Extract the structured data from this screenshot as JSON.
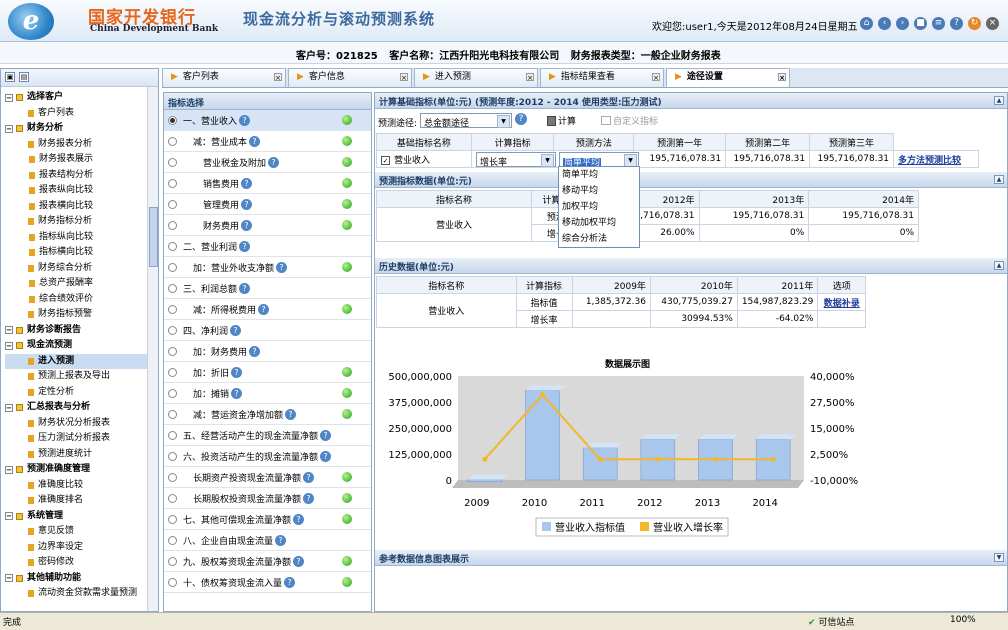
{
  "header": {
    "bank_name_cn": "国家开发银行",
    "bank_name_en": "China Development Bank",
    "system_title": "现金流分析与滚动预测系统",
    "welcome": "欢迎您:user1,今天是2012年08月24日星期五"
  },
  "toolbar_icons": [
    "home-icon",
    "back-icon",
    "forward-icon",
    "stop-icon",
    "book-icon",
    "help-icon",
    "refresh-icon",
    "exit-icon"
  ],
  "customer": {
    "id_label": "客户号：021825",
    "name_label": "客户名称：江西升阳光电科技有限公司",
    "report_type_label": "财务报表类型：一般企业财务报表"
  },
  "sidebar": {
    "items": [
      {
        "label": "选择客户",
        "level": 0,
        "bold": true
      },
      {
        "label": "客户列表",
        "level": 1
      },
      {
        "label": "财务分析",
        "level": 0,
        "bold": true
      },
      {
        "label": "财务报表分析",
        "level": 1
      },
      {
        "label": "财务报表展示",
        "level": 2
      },
      {
        "label": "报表结构分析",
        "level": 2
      },
      {
        "label": "报表纵向比较",
        "level": 2
      },
      {
        "label": "报表横向比较",
        "level": 2
      },
      {
        "label": "财务指标分析",
        "level": 1
      },
      {
        "label": "指标纵向比较",
        "level": 2
      },
      {
        "label": "指标横向比较",
        "level": 2
      },
      {
        "label": "财务综合分析",
        "level": 1
      },
      {
        "label": "总资产报酬率",
        "level": 2
      },
      {
        "label": "综合绩效评价",
        "level": 2
      },
      {
        "label": "财务指标预警",
        "level": 1
      },
      {
        "label": "财务诊断报告",
        "level": 0,
        "bold": true
      },
      {
        "label": "现金流预测",
        "level": 0,
        "bold": true
      },
      {
        "label": "进入预测",
        "level": 1,
        "bold": true,
        "selected": true
      },
      {
        "label": "预测上报表及导出",
        "level": 1
      },
      {
        "label": "定性分析",
        "level": 1
      },
      {
        "label": "汇总报表与分析",
        "level": 0,
        "bold": true
      },
      {
        "label": "财务状况分析报表",
        "level": 1
      },
      {
        "label": "压力测试分析报表",
        "level": 1
      },
      {
        "label": "预测进度统计",
        "level": 1
      },
      {
        "label": "预测准确度管理",
        "level": 0,
        "bold": true
      },
      {
        "label": "准确度比较",
        "level": 1
      },
      {
        "label": "准确度排名",
        "level": 1
      },
      {
        "label": "系统管理",
        "level": 0,
        "bold": true
      },
      {
        "label": "意见反馈",
        "level": 1
      },
      {
        "label": "边界率设定",
        "level": 1
      },
      {
        "label": "密码修改",
        "level": 1
      },
      {
        "label": "其他辅助功能",
        "level": 0,
        "bold": true
      },
      {
        "label": "流动资金贷款需求量预测",
        "level": 1
      }
    ]
  },
  "tabs": [
    {
      "label": "客户列表",
      "active": false
    },
    {
      "label": "客户信息",
      "active": false
    },
    {
      "label": "进入预测",
      "active": false
    },
    {
      "label": "指标结果查看",
      "active": false
    },
    {
      "label": "途径设置",
      "active": true
    }
  ],
  "indicator_panel": {
    "title": "指标选择",
    "items": [
      {
        "label": "一、营业收入",
        "help": true,
        "green": true,
        "selected": true
      },
      {
        "label": "减：营业成本",
        "help": true,
        "green": true,
        "indent": 1
      },
      {
        "label": "营业税金及附加",
        "help": true,
        "green": true,
        "indent": 2
      },
      {
        "label": "销售费用",
        "help": true,
        "green": true,
        "indent": 2
      },
      {
        "label": "管理费用",
        "help": true,
        "green": true,
        "indent": 2
      },
      {
        "label": "财务费用",
        "help": true,
        "green": true,
        "indent": 2
      },
      {
        "label": "二、营业利润",
        "help": true,
        "green": false
      },
      {
        "label": "加：营业外收支净额",
        "help": true,
        "green": true,
        "indent": 1
      },
      {
        "label": "三、利润总额",
        "help": true,
        "green": false
      },
      {
        "label": "减：所得税费用",
        "help": true,
        "green": true,
        "indent": 1
      },
      {
        "label": "四、净利润",
        "help": true,
        "green": false
      },
      {
        "label": "加：财务费用",
        "help": true,
        "green": false,
        "indent": 1
      },
      {
        "label": "加：折旧",
        "help": true,
        "green": true,
        "indent": 1
      },
      {
        "label": "加：摊销",
        "help": true,
        "green": true,
        "indent": 1
      },
      {
        "label": "减：营运资金净增加额",
        "help": true,
        "green": true,
        "indent": 1
      },
      {
        "label": "五、经营活动产生的现金流量净额",
        "help": true,
        "green": false
      },
      {
        "label": "六、投资活动产生的现金流量净额",
        "help": true,
        "green": false
      },
      {
        "label": "长期资产投资现金流量净额",
        "help": true,
        "green": true,
        "indent": 1
      },
      {
        "label": "长期股权投资现金流量净额",
        "help": true,
        "green": true,
        "indent": 1
      },
      {
        "label": "七、其他可偿现金流量净额",
        "help": true,
        "green": true
      },
      {
        "label": "八、企业自由现金流量",
        "help": true,
        "green": false
      },
      {
        "label": "九、股权筹资现金流量净额",
        "help": true,
        "green": true
      },
      {
        "label": "十、债权筹资现金流入量",
        "help": true,
        "green": true
      }
    ]
  },
  "calc_section": {
    "title": "计算基础指标(单位:元)  (预测年度:2012 - 2014   使用类型:压力测试)",
    "path_label": "预测途径:",
    "path_value": "总金额途径",
    "calc_button": "计算",
    "custom_button": "自定义指标",
    "headers": [
      "基础指标名称",
      "计算指标",
      "预测方法",
      "预测第一年",
      "预测第二年",
      "预测第三年"
    ],
    "row": {
      "name": "营业收入",
      "calc_indicator": "增长率",
      "method": "简单平均",
      "year1": "195,716,078.31",
      "year2": "195,716,078.31",
      "year3": "195,716,078.31",
      "link": "多方法预测比较"
    },
    "method_options": [
      "简单平均",
      "移动平均",
      "加权平均",
      "移动加权平均",
      "综合分析法"
    ]
  },
  "forecast_section": {
    "title": "预测指标数据(单位:元)",
    "headers": [
      "指标名称",
      "计算指标",
      "2012年",
      "2013年",
      "2014年"
    ],
    "indicator": "营业收入",
    "rows": [
      {
        "calc": "预测值",
        "v2012": "195,716,078.31",
        "v2013": "195,716,078.31",
        "v2014": "195,716,078.31"
      },
      {
        "calc": "增长率",
        "v2012": "26.00%",
        "v2013": "0%",
        "v2014": "0%"
      }
    ]
  },
  "history_section": {
    "title": "历史数据(单位:元)",
    "headers": [
      "指标名称",
      "计算指标",
      "2009年",
      "2010年",
      "2011年",
      "选项"
    ],
    "indicator": "营业收入",
    "rows": [
      {
        "calc": "指标值",
        "v2009": "1,385,372.36",
        "v2010": "430,775,039.27",
        "v2011": "154,987,823.29",
        "option": "数据补录"
      },
      {
        "calc": "增长率",
        "v2009": "",
        "v2010": "30994.53%",
        "v2011": "-64.02%",
        "option": ""
      }
    ]
  },
  "chart_data": {
    "type": "bar",
    "title": "数据展示图",
    "categories": [
      "2009",
      "2010",
      "2011",
      "2012",
      "2013",
      "2014"
    ],
    "series": [
      {
        "name": "营业收入指标值",
        "type": "bar",
        "axis": "left",
        "color": "#a9c6ec",
        "values": [
          1385372.36,
          430775039.27,
          154987823.29,
          195716078.31,
          195716078.31,
          195716078.31
        ]
      },
      {
        "name": "营业收入增长率",
        "type": "line",
        "axis": "right",
        "color": "#f0b82a",
        "values": [
          0,
          30994.53,
          -64.02,
          26.0,
          0,
          0
        ]
      }
    ],
    "y_left": {
      "min": 0,
      "max": 500000000,
      "ticks": [
        "0",
        "125,000,000",
        "250,000,000",
        "375,000,000",
        "500,000,000"
      ]
    },
    "y_right": {
      "min": -10000,
      "max": 40000,
      "ticks": [
        "-10,000%",
        "2,500%",
        "15,000%",
        "27,500%",
        "40,000%"
      ]
    },
    "legend": "bottom"
  },
  "reference_section": {
    "title": "参考数据信息图表展示"
  },
  "statusbar": {
    "text": "完成",
    "zone": "可信站点",
    "zoom": "100%"
  }
}
